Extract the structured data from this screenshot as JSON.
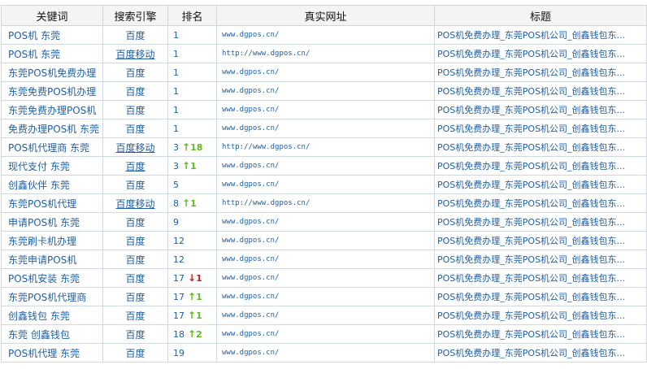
{
  "header": {
    "keyword": "关键词",
    "engine": "搜索引擎",
    "rank": "排名",
    "url": "真实网址",
    "title": "标题"
  },
  "rows": [
    {
      "kw": "POS机 东莞",
      "engine": "百度",
      "ul": false,
      "rank": "1",
      "arrow": "",
      "dir": "",
      "delta": "",
      "url": "www.dgpos.cn/",
      "title": "POS机免费办理_东莞POS机公司_创鑫钱包东..."
    },
    {
      "kw": "POS机 东莞",
      "engine": "百度移动",
      "ul": true,
      "rank": "1",
      "arrow": "",
      "dir": "",
      "delta": "",
      "url": "http://www.dgpos.cn/",
      "title": "POS机免费办理_东莞POS机公司_创鑫钱包东..."
    },
    {
      "kw": "东莞POS机免费办理",
      "engine": "百度",
      "ul": false,
      "rank": "1",
      "arrow": "",
      "dir": "",
      "delta": "",
      "url": "www.dgpos.cn/",
      "title": "POS机免费办理_东莞POS机公司_创鑫钱包东..."
    },
    {
      "kw": "东莞免费POS机办理",
      "engine": "百度",
      "ul": false,
      "rank": "1",
      "arrow": "",
      "dir": "",
      "delta": "",
      "url": "www.dgpos.cn/",
      "title": "POS机免费办理_东莞POS机公司_创鑫钱包东..."
    },
    {
      "kw": "东莞免费办理POS机",
      "engine": "百度",
      "ul": false,
      "rank": "1",
      "arrow": "",
      "dir": "",
      "delta": "",
      "url": "www.dgpos.cn/",
      "title": "POS机免费办理_东莞POS机公司_创鑫钱包东..."
    },
    {
      "kw": "免费办理POS机 东莞",
      "engine": "百度",
      "ul": false,
      "rank": "1",
      "arrow": "",
      "dir": "",
      "delta": "",
      "url": "www.dgpos.cn/",
      "title": "POS机免费办理_东莞POS机公司_创鑫钱包东..."
    },
    {
      "kw": "POS机代理商 东莞",
      "engine": "百度移动",
      "ul": true,
      "rank": "3",
      "arrow": "↑",
      "dir": "up",
      "delta": "18",
      "url": "http://www.dgpos.cn/",
      "title": "POS机免费办理_东莞POS机公司_创鑫钱包东..."
    },
    {
      "kw": "现代支付 东莞",
      "engine": "百度",
      "ul": true,
      "rank": "3",
      "arrow": "↑",
      "dir": "up",
      "delta": "1",
      "url": "www.dgpos.cn/",
      "title": "POS机免费办理_东莞POS机公司_创鑫钱包东..."
    },
    {
      "kw": "创鑫伙伴 东莞",
      "engine": "百度",
      "ul": false,
      "rank": "5",
      "arrow": "",
      "dir": "",
      "delta": "",
      "url": "www.dgpos.cn/",
      "title": "POS机免费办理_东莞POS机公司_创鑫钱包东..."
    },
    {
      "kw": "东莞POS机代理",
      "engine": "百度移动",
      "ul": true,
      "rank": "8",
      "arrow": "↑",
      "dir": "up",
      "delta": "1",
      "url": "http://www.dgpos.cn/",
      "title": "POS机免费办理_东莞POS机公司_创鑫钱包东..."
    },
    {
      "kw": "申请POS机 东莞",
      "engine": "百度",
      "ul": false,
      "rank": "9",
      "arrow": "",
      "dir": "",
      "delta": "",
      "url": "www.dgpos.cn/",
      "title": "POS机免费办理_东莞POS机公司_创鑫钱包东..."
    },
    {
      "kw": "东莞刷卡机办理",
      "engine": "百度",
      "ul": false,
      "rank": "12",
      "arrow": "",
      "dir": "",
      "delta": "",
      "url": "www.dgpos.cn/",
      "title": "POS机免费办理_东莞POS机公司_创鑫钱包东..."
    },
    {
      "kw": "东莞申请POS机",
      "engine": "百度",
      "ul": false,
      "rank": "12",
      "arrow": "",
      "dir": "",
      "delta": "",
      "url": "www.dgpos.cn/",
      "title": "POS机免费办理_东莞POS机公司_创鑫钱包东..."
    },
    {
      "kw": "POS机安装 东莞",
      "engine": "百度",
      "ul": false,
      "rank": "17",
      "arrow": "↓",
      "dir": "down",
      "delta": "1",
      "url": "www.dgpos.cn/",
      "title": "POS机免费办理_东莞POS机公司_创鑫钱包东..."
    },
    {
      "kw": "东莞POS机代理商",
      "engine": "百度",
      "ul": false,
      "rank": "17",
      "arrow": "↑",
      "dir": "up",
      "delta": "1",
      "url": "www.dgpos.cn/",
      "title": "POS机免费办理_东莞POS机公司_创鑫钱包东..."
    },
    {
      "kw": "创鑫钱包 东莞",
      "engine": "百度",
      "ul": false,
      "rank": "17",
      "arrow": "↑",
      "dir": "up",
      "delta": "1",
      "url": "www.dgpos.cn/",
      "title": "POS机免费办理_东莞POS机公司_创鑫钱包东..."
    },
    {
      "kw": "东莞 创鑫钱包",
      "engine": "百度",
      "ul": false,
      "rank": "18",
      "arrow": "↑",
      "dir": "up",
      "delta": "2",
      "url": "www.dgpos.cn/",
      "title": "POS机免费办理_东莞POS机公司_创鑫钱包东..."
    },
    {
      "kw": "POS机代理 东莞",
      "engine": "百度",
      "ul": false,
      "rank": "19",
      "arrow": "",
      "dir": "",
      "delta": "",
      "url": "www.dgpos.cn/",
      "title": "POS机免费办理_东莞POS机公司_创鑫钱包东..."
    }
  ]
}
